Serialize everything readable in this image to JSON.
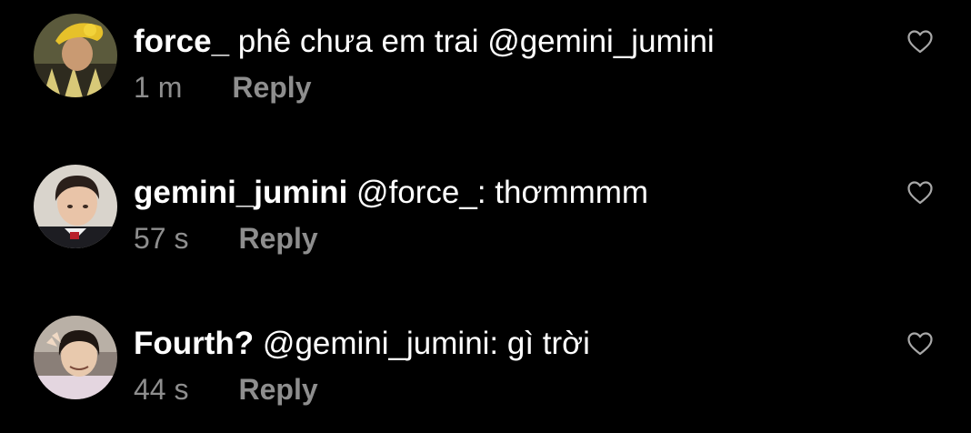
{
  "comments": [
    {
      "username": "force_",
      "text": "phê chưa em trai @gemini_jumini",
      "time": "1 m",
      "reply_label": "Reply",
      "avatar_icon": "avatar-photo-icon",
      "like_icon": "heart-outline-icon"
    },
    {
      "username": "gemini_jumini",
      "text": "@force_: thơmmmm",
      "time": "57 s",
      "reply_label": "Reply",
      "avatar_icon": "avatar-photo-icon",
      "like_icon": "heart-outline-icon"
    },
    {
      "username": "Fourth?",
      "text": "@gemini_jumini: gì trời",
      "time": "44 s",
      "reply_label": "Reply",
      "avatar_icon": "avatar-photo-icon",
      "like_icon": "heart-outline-icon"
    }
  ],
  "colors": {
    "background": "#000000",
    "primary_text": "#ffffff",
    "secondary_text": "#8e8e8e",
    "heart_outline": "#a8a8a8"
  }
}
